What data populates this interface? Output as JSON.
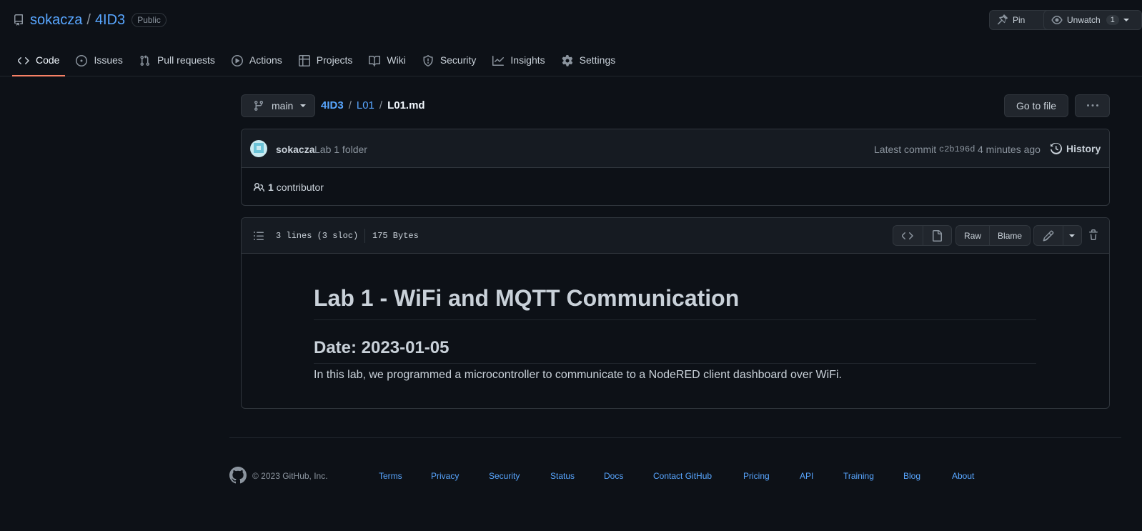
{
  "repo": {
    "owner": "sokacza",
    "name": "4ID3",
    "visibility": "Public",
    "pin_label": "Pin",
    "watch_label": "Unwatch",
    "watch_count": "1"
  },
  "nav": {
    "code": "Code",
    "issues": "Issues",
    "pulls": "Pull requests",
    "actions": "Actions",
    "projects": "Projects",
    "wiki": "Wiki",
    "security": "Security",
    "insights": "Insights",
    "settings": "Settings"
  },
  "branch": "main",
  "breadcrumb": {
    "root": "4ID3",
    "folder": "L01",
    "file": "L01.md"
  },
  "toolbar": {
    "goto_file": "Go to file"
  },
  "commit": {
    "author": "sokacza",
    "message": "Lab 1 folder",
    "latest_label": "Latest commit",
    "sha": "c2b196d",
    "time": "4 minutes ago",
    "history": "History",
    "contributors_count": "1",
    "contributors_label": "contributor"
  },
  "file": {
    "lines": "3 lines (3 sloc)",
    "size": "175 Bytes",
    "raw": "Raw",
    "blame": "Blame"
  },
  "markdown": {
    "h1": "Lab 1 - WiFi and MQTT Communication",
    "h2": "Date: 2023-01-05",
    "p": "In this lab, we programmed a microcontroller to communicate to a NodeRED client dashboard over WiFi."
  },
  "footer": {
    "copyright": "© 2023 GitHub, Inc.",
    "terms": "Terms",
    "privacy": "Privacy",
    "security": "Security",
    "status": "Status",
    "docs": "Docs",
    "contact": "Contact GitHub",
    "pricing": "Pricing",
    "api": "API",
    "training": "Training",
    "blog": "Blog",
    "about": "About"
  }
}
